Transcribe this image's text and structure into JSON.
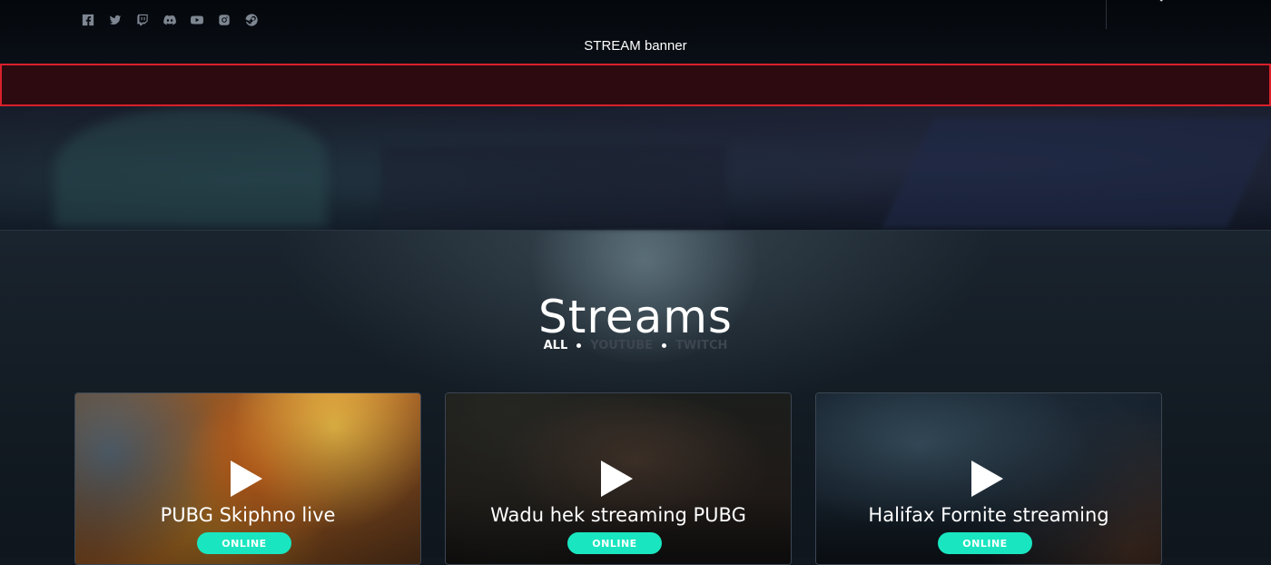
{
  "header": {
    "social_icons": [
      "facebook-icon",
      "twitter-icon",
      "twitch-icon",
      "discord-icon",
      "youtube-icon",
      "instagram-icon",
      "steam-icon"
    ],
    "banner_label": "STREAM banner"
  },
  "streams": {
    "title": "Streams",
    "filters": [
      {
        "label": "ALL",
        "active": true
      },
      {
        "label": "YOUTUBE",
        "active": false
      },
      {
        "label": "TWITCH",
        "active": false
      }
    ],
    "cards": [
      {
        "name": "PUBG Skiphno live",
        "status": "ONLINE"
      },
      {
        "name": "Wadu hek streaming PUBG",
        "status": "ONLINE"
      },
      {
        "name": "Halifax Fornite streaming",
        "status": "ONLINE"
      }
    ]
  },
  "colors": {
    "accent": "#19e6c0",
    "highlight_border": "#d9202b"
  }
}
